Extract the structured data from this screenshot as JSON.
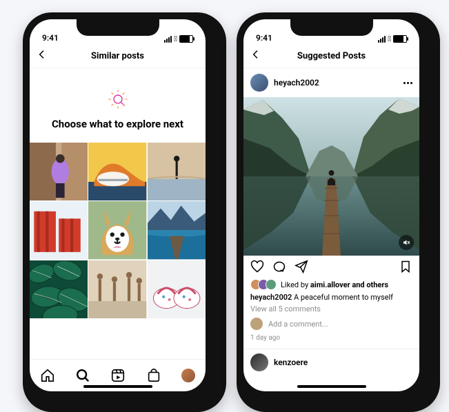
{
  "status": {
    "time": "9:41"
  },
  "phone_left": {
    "title": "Similar posts",
    "explore_heading": "Choose what to explore next",
    "tabbar": {
      "active": "search"
    }
  },
  "phone_right": {
    "title": "Suggested Posts",
    "post": {
      "username": "heyach2002",
      "liked_by_lead": "aimi.allover",
      "liked_by_suffix": "and others",
      "liked_by_prefix": "Liked by",
      "caption_user": "heyach2002",
      "caption_text": "A peaceful moment to myself",
      "view_all": "View all 5 comments",
      "add_comment_placeholder": "Add a comment...",
      "age": "1 day ago"
    },
    "next_post": {
      "username": "kenzoere"
    }
  }
}
